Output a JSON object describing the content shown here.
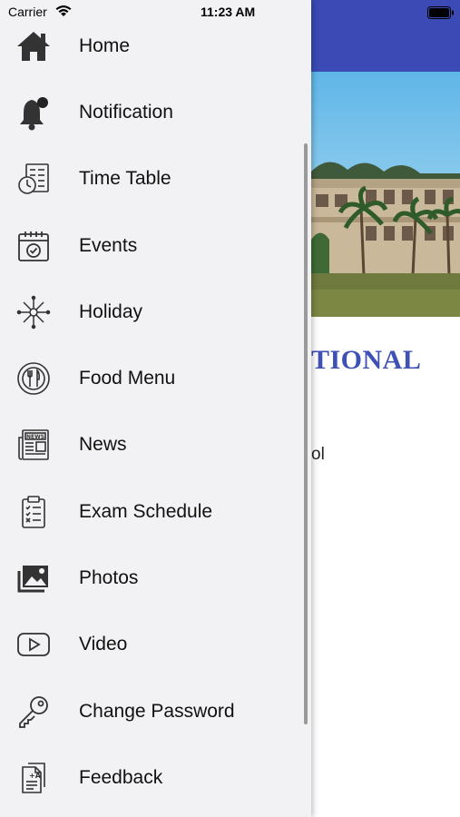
{
  "status_bar": {
    "carrier": "Carrier",
    "time": "11:23 AM"
  },
  "main": {
    "title_fragment": "TIONAL",
    "subtitle_fragment": "ol",
    "app_bar_color": "#3b4ab5",
    "title_color": "#3f51b5"
  },
  "drawer": {
    "items": [
      {
        "label": "Home",
        "icon": "home-icon"
      },
      {
        "label": "Notification",
        "icon": "bell-icon"
      },
      {
        "label": "Time Table",
        "icon": "timetable-icon"
      },
      {
        "label": "Events",
        "icon": "calendar-icon"
      },
      {
        "label": "Holiday",
        "icon": "fireworks-icon"
      },
      {
        "label": "Food Menu",
        "icon": "food-icon"
      },
      {
        "label": "News",
        "icon": "newspaper-icon"
      },
      {
        "label": "Exam Schedule",
        "icon": "clipboard-icon"
      },
      {
        "label": "Photos",
        "icon": "photos-icon"
      },
      {
        "label": "Video",
        "icon": "video-icon"
      },
      {
        "label": "Change Password",
        "icon": "key-icon"
      },
      {
        "label": "Feedback",
        "icon": "feedback-icon"
      }
    ]
  }
}
